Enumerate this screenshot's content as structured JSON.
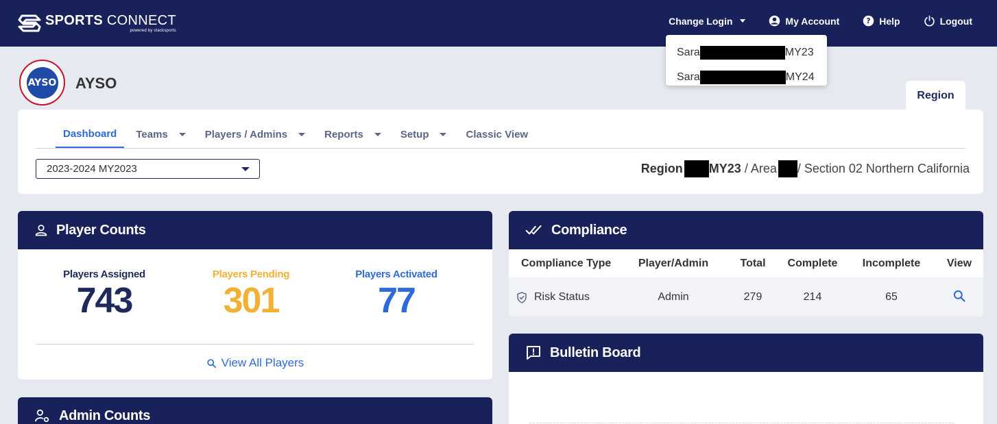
{
  "brand": {
    "name_bold": "SPORTS",
    "name_light": " CONNECT",
    "tagline": "powered by stacksports"
  },
  "topnav": {
    "change_login": "Change Login",
    "my_account": "My Account",
    "help": "Help",
    "logout": "Logout"
  },
  "login_menu": {
    "options": [
      {
        "prefix": "Sara",
        "suffix": "MY23"
      },
      {
        "prefix": "Sara",
        "suffix": "MY24"
      }
    ]
  },
  "org": {
    "logo_text": "AYSO",
    "name": "AYSO",
    "region_tab": "Region"
  },
  "nav": {
    "tabs": [
      {
        "label": "Dashboard",
        "active": true
      },
      {
        "label": "Teams"
      },
      {
        "label": "Players / Admins"
      },
      {
        "label": "Reports"
      },
      {
        "label": "Setup"
      },
      {
        "label": "Classic View"
      }
    ],
    "season": "2023-2024 MY2023",
    "breadcrumb": {
      "region_label": "Region",
      "region_suffix": "MY23",
      "area_sep": " / Area",
      "section": "/ Section 02 Northern California"
    }
  },
  "player_counts": {
    "title": "Player Counts",
    "assigned_label": "Players Assigned",
    "assigned_value": "743",
    "pending_label": "Players Pending",
    "pending_value": "301",
    "activated_label": "Players Activated",
    "activated_value": "77",
    "view_all": "View All Players"
  },
  "admin_counts": {
    "title": "Admin Counts"
  },
  "compliance": {
    "title": "Compliance",
    "headers": [
      "Compliance Type",
      "Player/Admin",
      "Total",
      "Complete",
      "Incomplete",
      "View"
    ],
    "row": {
      "type": "Risk Status",
      "who": "Admin",
      "total": "279",
      "complete": "214",
      "incomplete": "65"
    }
  },
  "bulletin": {
    "title": "Bulletin Board"
  },
  "colors": {
    "navy": "#18215a",
    "assigned": "#1d2a5b",
    "pending": "#f0b135",
    "activated": "#2f6bd8"
  }
}
